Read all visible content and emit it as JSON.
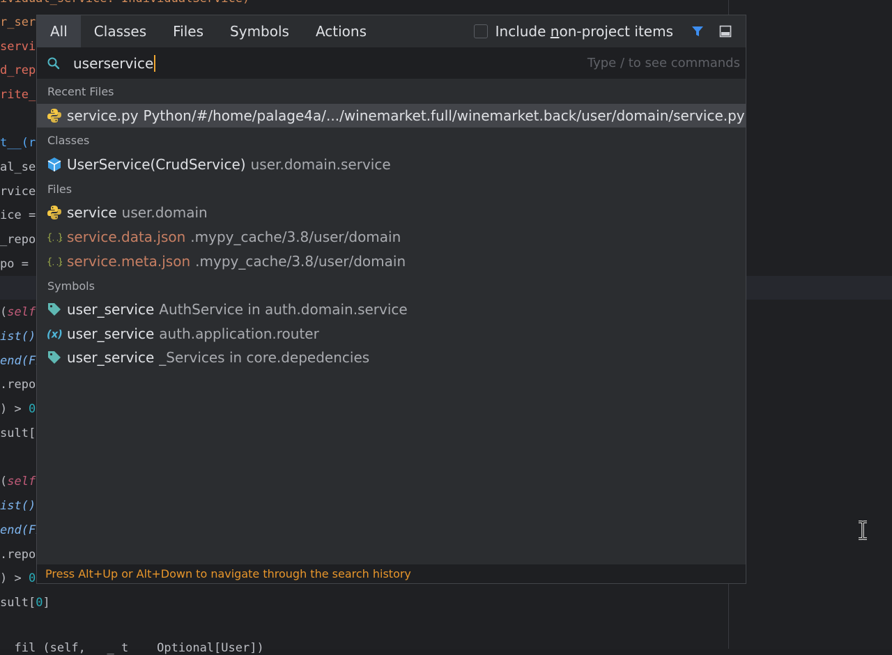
{
  "tabs": [
    "All",
    "Classes",
    "Files",
    "Symbols",
    "Actions"
  ],
  "include_label_pre": "Include ",
  "include_label_u": "n",
  "include_label_post": "on-project items",
  "search": {
    "value": "userservice",
    "hint": "Type / to see commands"
  },
  "sections": {
    "recent": "Recent Files",
    "classes": "Classes",
    "files": "Files",
    "symbols": "Symbols"
  },
  "recent_files": [
    {
      "name": "service.py",
      "path": "Python/#/home/palage4a/.../winemarket.full/winemarket.back/user/domain/service.py",
      "icon": "python-icon"
    }
  ],
  "classes": [
    {
      "name": "UserService(CrudService)",
      "path": "user.domain.service",
      "icon": "class-icon"
    }
  ],
  "files": [
    {
      "name": "service",
      "path": "user.domain",
      "icon": "python-icon"
    },
    {
      "name": "service.data.json",
      "path": ".mypy_cache/3.8/user/domain",
      "icon": "json-icon"
    },
    {
      "name": "service.meta.json",
      "path": ".mypy_cache/3.8/user/domain",
      "icon": "json-icon"
    }
  ],
  "symbols": [
    {
      "name": "user_service",
      "path": "AuthService in auth.domain.service",
      "icon": "tag-icon"
    },
    {
      "name": "user_service",
      "path": "auth.application.router",
      "icon": "variable-icon"
    },
    {
      "name": "user_service",
      "path": "_Services in core.depedencies",
      "icon": "tag-icon"
    }
  ],
  "footer": "Press Alt+Up or Alt+Down to navigate through the search history",
  "code": {
    "l1": "ividual_service: IndividualService)",
    "l2": "r_serv",
    "l3": "servic",
    "l4": "d_repo",
    "l5": "rite_r",
    "l6": "t__(re",
    "l7": "al_ser",
    "l8": "rvice",
    "l9": "ice =",
    "l10": "_repo",
    "l11": "po = ",
    "l12a": "(",
    "l12b": "self",
    "l13": "ist()",
    "l14": "end(Fi",
    "l15": ".repo",
    "l16a": ") > ",
    "l16b": "0",
    "l17": "sult[",
    "l18a": "(",
    "l18b": "self",
    "l19": "ist()",
    "l20": "end(Fi",
    "l21": ".repo",
    "l22a": ") > ",
    "l22b": "0",
    "l23a": "sult[",
    "l23b": "0",
    "l23c": "]",
    "l24": "  fil (self,   _ t    Optional[User])"
  },
  "colors": {
    "accent": "#3574f0",
    "warning": "#e8962b",
    "json": "#c77f63",
    "background": "#2b2d30"
  }
}
